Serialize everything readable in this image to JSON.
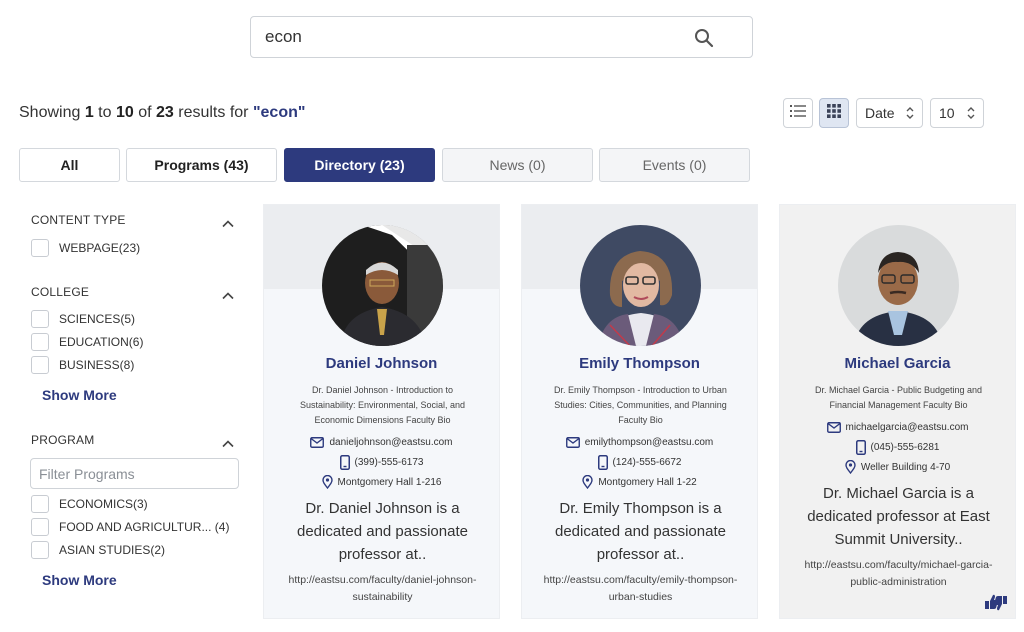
{
  "search": {
    "value": "econ"
  },
  "results": {
    "prefix": "Showing ",
    "from": "1",
    "to_word": " to ",
    "to": "10",
    "of_word": " of ",
    "total": "23",
    "for_word": " results for ",
    "query": "\"econ\""
  },
  "controls": {
    "sort_value": "Date",
    "per_page_value": "10"
  },
  "tabs": [
    {
      "label": "All"
    },
    {
      "label": "Programs (43)"
    },
    {
      "label": "Directory (23)"
    },
    {
      "label": "News (0)"
    },
    {
      "label": "Events (0)"
    }
  ],
  "sidebar": {
    "content_type": {
      "title": "CONTENT TYPE",
      "options": [
        {
          "label": "WEBPAGE(23)"
        }
      ]
    },
    "college": {
      "title": "COLLEGE",
      "options": [
        {
          "label": "SCIENCES(5)"
        },
        {
          "label": "EDUCATION(6)"
        },
        {
          "label": "BUSINESS(8)"
        }
      ],
      "show_more": "Show More"
    },
    "program": {
      "title": "PROGRAM",
      "filter_placeholder": "Filter Programs",
      "options": [
        {
          "label": "ECONOMICS(3)"
        },
        {
          "label": "FOOD AND AGRICULTUR... (4)"
        },
        {
          "label": "ASIAN STUDIES(2)"
        }
      ],
      "show_more": "Show More"
    }
  },
  "cards": [
    {
      "name": "Daniel Johnson",
      "title": "Dr. Daniel Johnson - Introduction to Sustainability: Environmental, Social, and Economic Dimensions Faculty Bio",
      "email": "danieljohnson@eastsu.com",
      "phone": "(399)-555-6173",
      "location": "Montgomery Hall 1-216",
      "bio": "Dr. Daniel Johnson is a dedicated and passionate professor at..",
      "url": "http://eastsu.com/faculty/daniel-johnson-sustainability"
    },
    {
      "name": "Emily Thompson",
      "title": "Dr. Emily Thompson - Introduction to Urban Studies: Cities, Communities, and Planning Faculty Bio",
      "email": "emilythompson@eastsu.com",
      "phone": "(124)-555-6672",
      "location": "Montgomery Hall 1-22",
      "bio": "Dr. Emily Thompson is a dedicated and passionate professor at..",
      "url": "http://eastsu.com/faculty/emily-thompson-urban-studies"
    },
    {
      "name": "Michael Garcia",
      "title": "Dr. Michael Garcia - Public Budgeting and Financial Management Faculty Bio",
      "email": "michaelgarcia@eastsu.com",
      "phone": "(045)-555-6281",
      "location": "Weller Building 4-70",
      "bio": "Dr. Michael Garcia is a dedicated professor at East Summit University..",
      "url": "http://eastsu.com/faculty/michael-garcia-public-administration"
    }
  ],
  "colors": {
    "brand": "#2d3a7e",
    "card_bg": "#f5f7fa"
  },
  "icons": [
    "search-icon",
    "list-view-icon",
    "grid-view-icon",
    "chevron-up-icon",
    "email-icon",
    "phone-icon",
    "location-icon",
    "feedback-icon"
  ]
}
